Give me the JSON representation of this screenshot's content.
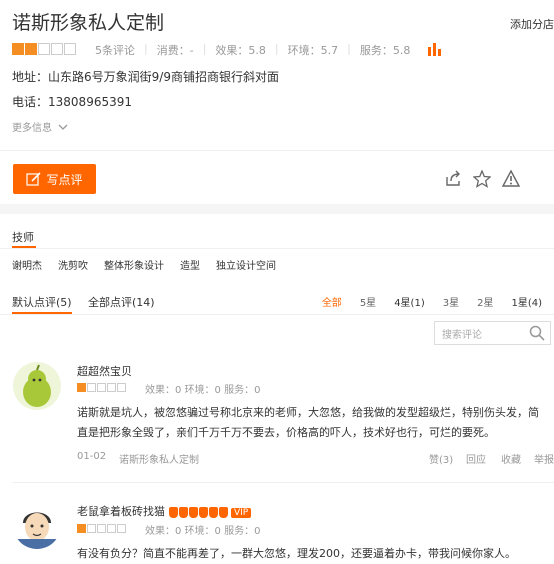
{
  "shop": {
    "title": "诺斯形象私人定制",
    "add_shop": "添加分店",
    "rating_stars": 2,
    "reviews_count": "5条评论",
    "consumption": "消费：-",
    "effect": "效果：5.8",
    "environment": "环境：5.7",
    "service": "服务：5.8",
    "address_label": "地址：",
    "address": "山东路6号万象润街9/9商铺招商银行斜对面",
    "phone_label": "电话：",
    "phone": "13808965391",
    "more_info": "更多信息"
  },
  "actions": {
    "write_review": "写点评"
  },
  "technicians": {
    "title": "技师",
    "items": [
      "谢明杰",
      "洗剪吹",
      "整体形象设计",
      "造型",
      "独立设计空间"
    ]
  },
  "review_tabs": {
    "default": "默认点评(5)",
    "all": "全部点评(14)"
  },
  "filters": [
    "全部",
    "5星",
    "4星(1)",
    "3星",
    "2星",
    "1星(4)"
  ],
  "search": {
    "placeholder": "搜索评论"
  },
  "reviews": [
    {
      "user": "超超然宝贝",
      "stars": 1,
      "scores": "效果：0   环境：0   服务：0",
      "text": "诺斯就是坑人，被忽悠骗过号称北京来的老师，大忽悠，给我做的发型超级烂，特别伤头发，简直是把形象全毁了，亲们千万千万不要去，价格高的吓人，技术好也行，可烂的要死。",
      "date": "01-02",
      "shop": "诺斯形象私人定制",
      "likes": "赞(3)",
      "reply": "回应",
      "fav": "收藏",
      "report": "举报"
    },
    {
      "user": "老鼠拿着板砖找猫",
      "vip": "VIP",
      "stars": 1,
      "scores": "效果：0   环境：0   服务：0",
      "text": "有没有负分？简直不能再差了，一群大忽悠，理发200，还要逼着办卡，带我问候你家人。"
    }
  ],
  "colors": {
    "accent": "#ff6600",
    "star": "#f58e22"
  }
}
